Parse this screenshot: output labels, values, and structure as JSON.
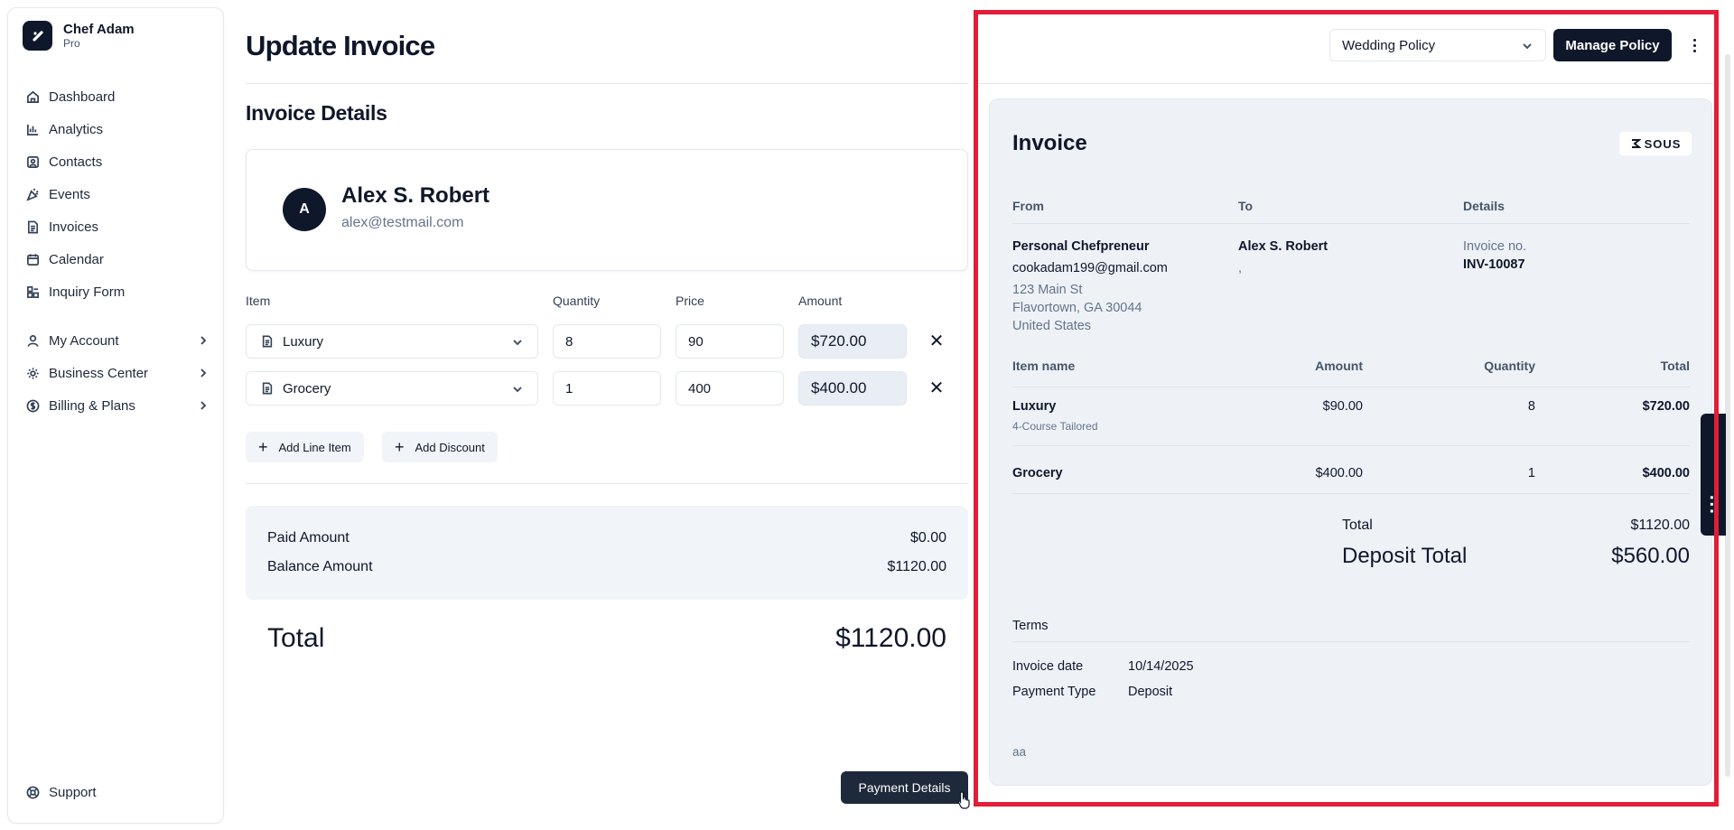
{
  "brand": {
    "name": "Chef Adam",
    "plan": "Pro"
  },
  "nav": {
    "items": [
      {
        "label": "Dashboard"
      },
      {
        "label": "Analytics"
      },
      {
        "label": "Contacts"
      },
      {
        "label": "Events"
      },
      {
        "label": "Invoices"
      },
      {
        "label": "Calendar"
      },
      {
        "label": "Inquiry Form"
      }
    ],
    "groups": [
      {
        "label": "My Account"
      },
      {
        "label": "Business Center"
      },
      {
        "label": "Billing & Plans"
      }
    ],
    "support": "Support"
  },
  "page": {
    "title": "Update Invoice",
    "section_title": "Invoice Details"
  },
  "client": {
    "initial": "A",
    "name": "Alex S. Robert",
    "email": "alex@testmail.com"
  },
  "line_items": {
    "headers": {
      "item": "Item",
      "quantity": "Quantity",
      "price": "Price",
      "amount": "Amount"
    },
    "rows": [
      {
        "item": "Luxury",
        "quantity": "8",
        "price": "90",
        "amount": "$720.00"
      },
      {
        "item": "Grocery",
        "quantity": "1",
        "price": "400",
        "amount": "$400.00"
      }
    ],
    "remove_glyph": "✕",
    "add_line_item": "Add Line Item",
    "add_discount": "Add Discount"
  },
  "summary": {
    "paid_label": "Paid Amount",
    "paid_value": "$0.00",
    "balance_label": "Balance Amount",
    "balance_value": "$1120.00",
    "total_label": "Total",
    "total_value": "$1120.00"
  },
  "payment_details_button": "Payment Details",
  "policy": {
    "selected": "Wedding Policy",
    "manage_button": "Manage Policy"
  },
  "invoice_preview": {
    "title": "Invoice",
    "logo_text": "SOUS",
    "headers": {
      "from": "From",
      "to": "To",
      "details": "Details"
    },
    "from": {
      "name": "Personal Chefpreneur",
      "email": "cookadam199@gmail.com",
      "address1": "123 Main St",
      "address2": "Flavortown, GA 30044",
      "country": "United States"
    },
    "to": {
      "name": "Alex S. Robert",
      "extra": ","
    },
    "details": {
      "invoice_no_label": "Invoice no.",
      "invoice_no": "INV-10087"
    },
    "table_headers": {
      "item_name": "Item name",
      "amount": "Amount",
      "quantity": "Quantity",
      "total": "Total"
    },
    "rows": [
      {
        "name": "Luxury",
        "sub": "4-Course Tailored",
        "amount": "$90.00",
        "quantity": "8",
        "total": "$720.00"
      },
      {
        "name": "Grocery",
        "sub": "",
        "amount": "$400.00",
        "quantity": "1",
        "total": "$400.00"
      }
    ],
    "total_label": "Total",
    "total_value": "$1120.00",
    "deposit_label": "Deposit Total",
    "deposit_value": "$560.00",
    "terms_label": "Terms",
    "invoice_date_label": "Invoice date",
    "invoice_date": "10/14/2025",
    "payment_type_label": "Payment Type",
    "payment_type": "Deposit",
    "notes": "aa"
  },
  "colors": {
    "primary": "#0f172a",
    "highlight_frame": "#e11d38",
    "panel_bg": "#eef2f7"
  }
}
